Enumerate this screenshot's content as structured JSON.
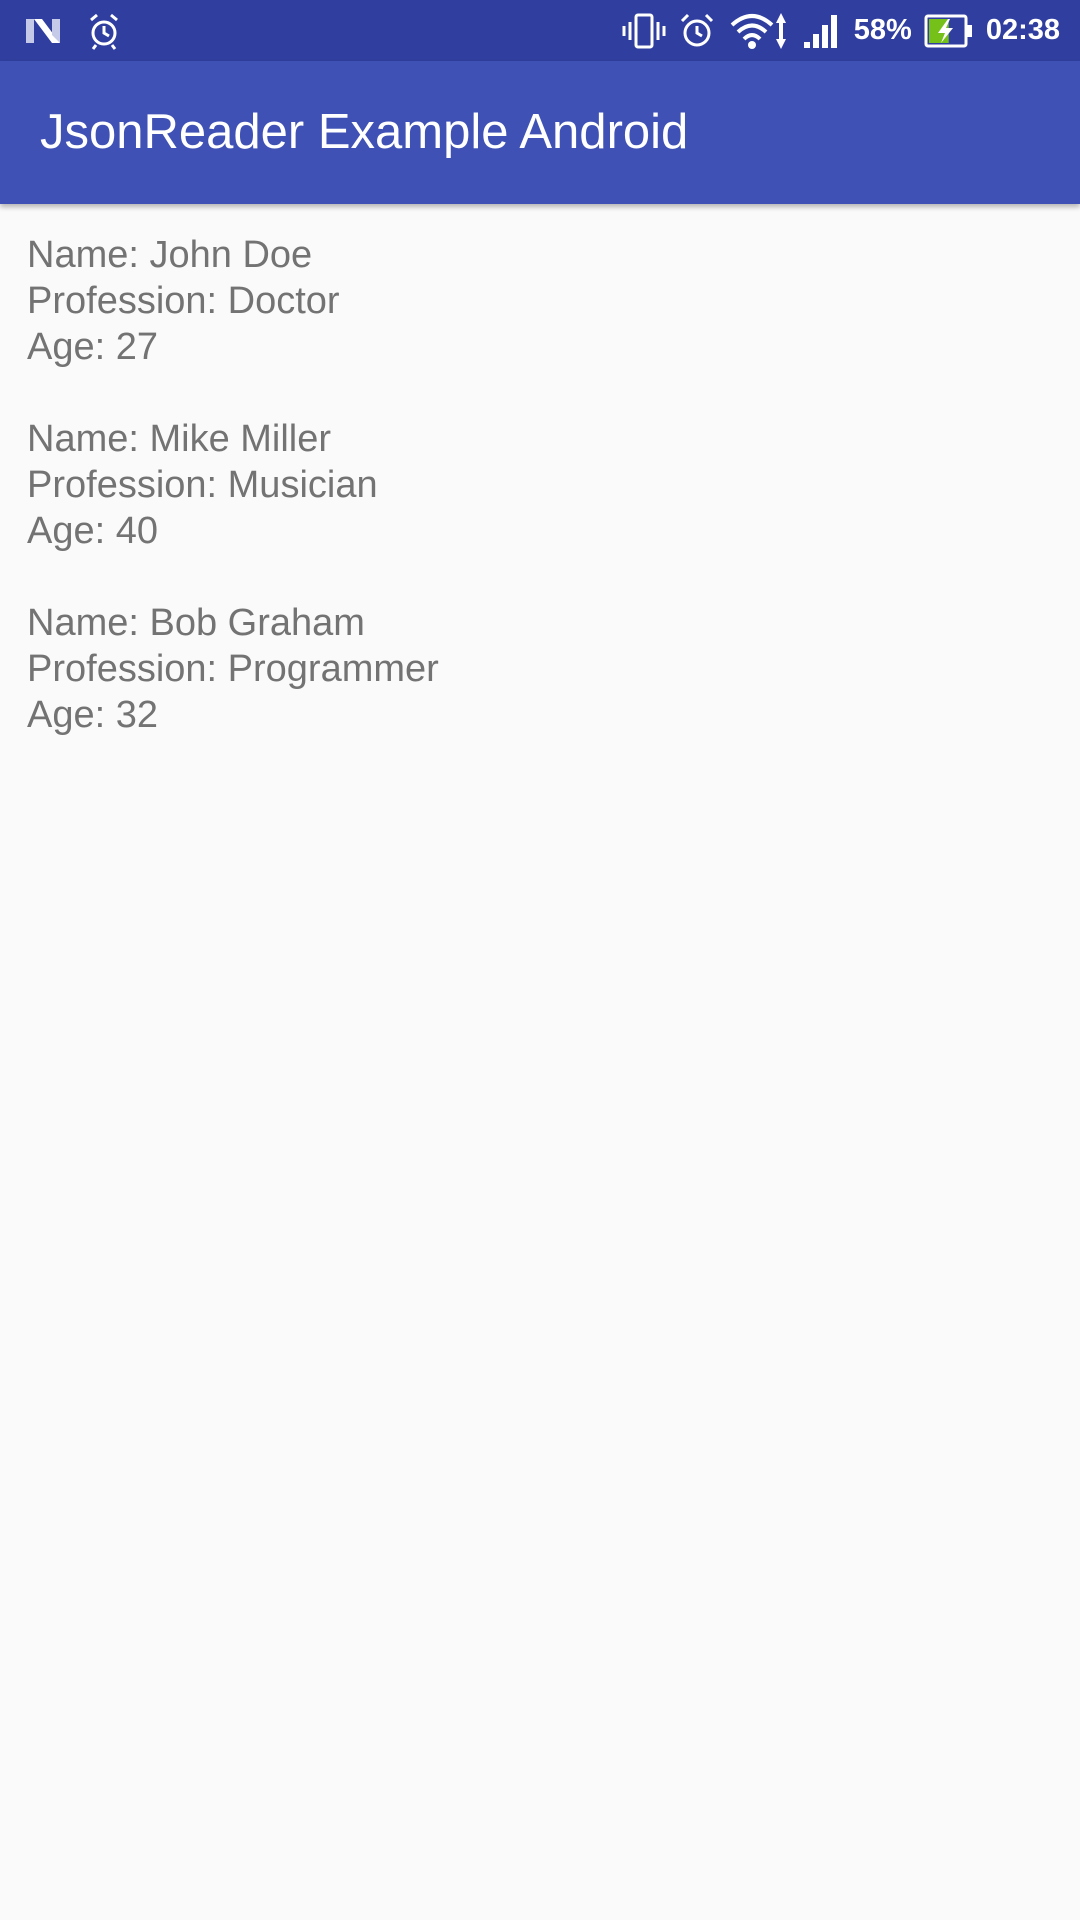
{
  "status_bar": {
    "icons_left": [
      "n-logo-icon",
      "alarm-icon"
    ],
    "icons_right": [
      "vibrate-icon",
      "alarm-icon",
      "wifi-icon",
      "signal-icon",
      "battery-charging-icon"
    ],
    "battery_percent": "58%",
    "battery_level": 0.58,
    "time": "02:38",
    "colors": {
      "background": "#303f9f",
      "battery_fill": "#76c01a"
    }
  },
  "app_bar": {
    "title": "JsonReader Example Android",
    "background": "#3f51b5"
  },
  "people": [
    {
      "name_line": "Name: John Doe",
      "profession_line": "Profession: Doctor",
      "age_line": "Age: 27"
    },
    {
      "name_line": "Name: Mike Miller",
      "profession_line": "Profession: Musician",
      "age_line": "Age: 40"
    },
    {
      "name_line": "Name: Bob Graham",
      "profession_line": "Profession: Programmer",
      "age_line": "Age: 32"
    }
  ]
}
